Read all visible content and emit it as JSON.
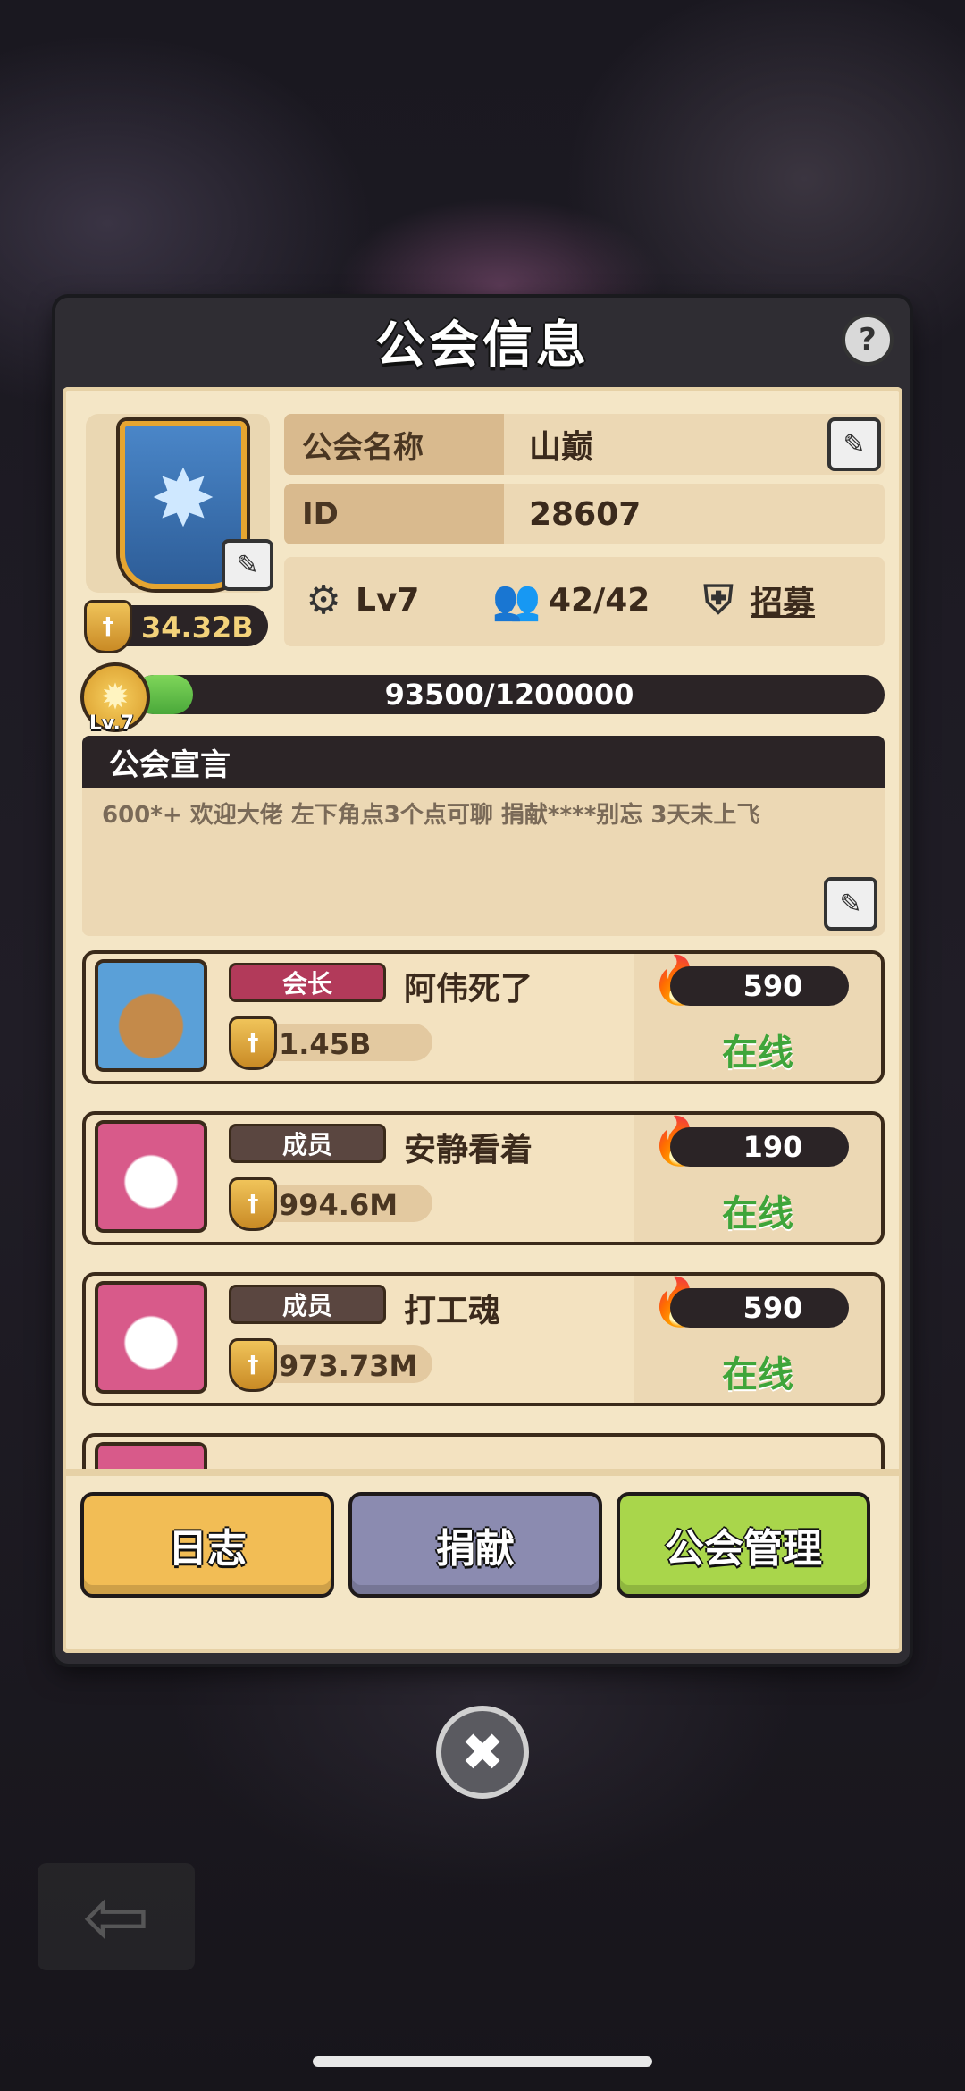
{
  "title": "公会信息",
  "help_label": "?",
  "guild": {
    "power": "34.32B",
    "name_label": "公会名称",
    "name": "山巅",
    "id_label": "ID",
    "id": "28607",
    "level": "Lv7",
    "members": "42/42",
    "recruit_label": "招募",
    "exp_text": "93500/1200000",
    "exp_progress": 0.078,
    "level_badge": "Lv.7"
  },
  "announcement": {
    "title": "公会宣言",
    "text": "600*+  欢迎大佬 左下角点3个点可聊 捐献****别忘  3天未上飞"
  },
  "members": [
    {
      "role": "会长",
      "role_color": "#b23a5a",
      "name": "阿伟死了",
      "power": "1.45B",
      "activity": "590",
      "status": "在线",
      "avatar": "capybara-avatar"
    },
    {
      "role": "成员",
      "role_color": "#5a4640",
      "name": "安静看着",
      "power": "994.6M",
      "activity": "190",
      "status": "在线",
      "avatar": "dragon-avatar"
    },
    {
      "role": "成员",
      "role_color": "#5a4640",
      "name": "打工魂",
      "power": "973.73M",
      "activity": "590",
      "status": "在线",
      "avatar": "dragon-avatar"
    }
  ],
  "buttons": {
    "log": "日志",
    "donate": "捐献",
    "manage": "公会管理"
  },
  "colors": {
    "log_button": "#f2bd55",
    "donate_button": "#8b8bb0",
    "manage_button": "#a9d64b",
    "online": "#3fa53a"
  },
  "icons": {
    "close": "close-icon",
    "back": "back-arrow-icon",
    "edit": "edit-icon",
    "fire": "fire-icon"
  }
}
